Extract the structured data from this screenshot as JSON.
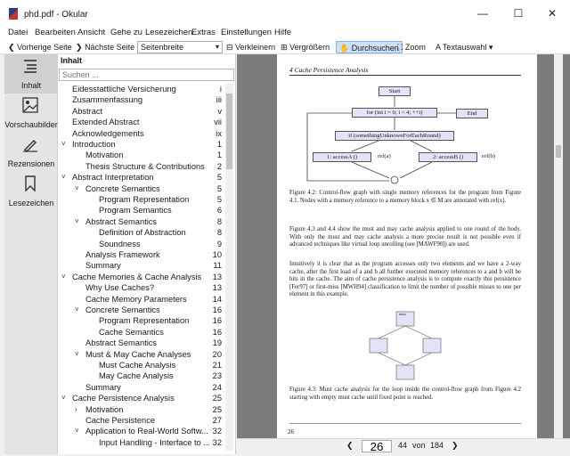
{
  "window": {
    "title": "phd.pdf - Okular",
    "minimize": "—",
    "maximize": "☐",
    "close": "✕"
  },
  "menu": [
    "Datei",
    "Bearbeiten",
    "Ansicht",
    "Gehe zu",
    "Lesezeichen",
    "Extras",
    "Einstellungen",
    "Hilfe"
  ],
  "toolbar": {
    "prev": "Vorherige Seite",
    "next": "Nächste Seite",
    "zoom_mode": "Seitenbreite",
    "zoom_out": "Verkleinern",
    "zoom_in": "Vergrößern",
    "browse": "Durchsuchen",
    "zoom": "Zoom",
    "text_select": "Textauswahl"
  },
  "sidebar": [
    {
      "label": "Inhalt",
      "icon": "contents-icon"
    },
    {
      "label": "Vorschaubilder",
      "icon": "thumbnails-icon"
    },
    {
      "label": "Rezensionen",
      "icon": "reviews-icon"
    },
    {
      "label": "Lesezeichen",
      "icon": "bookmarks-icon"
    }
  ],
  "toc": {
    "header": "Inhalt",
    "search_placeholder": "Suchen ...",
    "items": [
      {
        "label": "Eidesstattliche Versicherung",
        "page": "i",
        "level": 0,
        "arrow": ""
      },
      {
        "label": "Zusammenfassung",
        "page": "iii",
        "level": 0,
        "arrow": ""
      },
      {
        "label": "Abstract",
        "page": "v",
        "level": 0,
        "arrow": ""
      },
      {
        "label": "Extended Abstract",
        "page": "vii",
        "level": 0,
        "arrow": ""
      },
      {
        "label": "Acknowledgements",
        "page": "ix",
        "level": 0,
        "arrow": ""
      },
      {
        "label": "Introduction",
        "page": "1",
        "level": 0,
        "arrow": "down"
      },
      {
        "label": "Motivation",
        "page": "1",
        "level": 1,
        "arrow": ""
      },
      {
        "label": "Thesis Structure & Contributions",
        "page": "2",
        "level": 1,
        "arrow": ""
      },
      {
        "label": "Abstract Interpretation",
        "page": "5",
        "level": 0,
        "arrow": "down"
      },
      {
        "label": "Concrete Semantics",
        "page": "5",
        "level": 1,
        "arrow": "down"
      },
      {
        "label": "Program Representation",
        "page": "5",
        "level": 2,
        "arrow": ""
      },
      {
        "label": "Program Semantics",
        "page": "6",
        "level": 2,
        "arrow": ""
      },
      {
        "label": "Abstract Semantics",
        "page": "8",
        "level": 1,
        "arrow": "down"
      },
      {
        "label": "Definition of Abstraction",
        "page": "8",
        "level": 2,
        "arrow": ""
      },
      {
        "label": "Soundness",
        "page": "9",
        "level": 2,
        "arrow": ""
      },
      {
        "label": "Analysis Framework",
        "page": "10",
        "level": 1,
        "arrow": ""
      },
      {
        "label": "Summary",
        "page": "11",
        "level": 1,
        "arrow": ""
      },
      {
        "label": "Cache Memories & Cache Analysis",
        "page": "13",
        "level": 0,
        "arrow": "down"
      },
      {
        "label": "Why Use Caches?",
        "page": "13",
        "level": 1,
        "arrow": ""
      },
      {
        "label": "Cache Memory Parameters",
        "page": "14",
        "level": 1,
        "arrow": ""
      },
      {
        "label": "Concrete Semantics",
        "page": "16",
        "level": 1,
        "arrow": "down"
      },
      {
        "label": "Program Representation",
        "page": "16",
        "level": 2,
        "arrow": ""
      },
      {
        "label": "Cache Semantics",
        "page": "16",
        "level": 2,
        "arrow": ""
      },
      {
        "label": "Abstract Semantics",
        "page": "19",
        "level": 1,
        "arrow": ""
      },
      {
        "label": "Must & May Cache Analyses",
        "page": "20",
        "level": 1,
        "arrow": "down"
      },
      {
        "label": "Must Cache Analysis",
        "page": "21",
        "level": 2,
        "arrow": ""
      },
      {
        "label": "May Cache Analysis",
        "page": "23",
        "level": 2,
        "arrow": ""
      },
      {
        "label": "Summary",
        "page": "24",
        "level": 1,
        "arrow": ""
      },
      {
        "label": "Cache Persistence Analysis",
        "page": "25",
        "level": 0,
        "arrow": "down"
      },
      {
        "label": "Motivation",
        "page": "25",
        "level": 1,
        "arrow": "right"
      },
      {
        "label": "Cache Persistence",
        "page": "27",
        "level": 1,
        "arrow": ""
      },
      {
        "label": "Application to Real-World Softw...",
        "page": "32",
        "level": 1,
        "arrow": "down"
      },
      {
        "label": "Input Handling - Interface to ...",
        "page": "32",
        "level": 2,
        "arrow": ""
      }
    ]
  },
  "document": {
    "running_head": "4  Cache Persistence Analysis",
    "flow": {
      "start": "Start",
      "loop": "for (int i = 0; i < 4; ++i)",
      "end": "End",
      "cond": "if (somethingUnknownForEachRound)",
      "access_a": "1: accessA ()",
      "access_b": "2: accessB ()",
      "ref_a": "ref(a)",
      "ref_b": "ref(b)"
    },
    "caption_42": "Figure 4.2: Control-flow graph with single memory references for the program from Figure 4.1. Nodes with a memory reference to a memory block x ∈ M are annotated with ref(x).",
    "para1": "Figure 4.3 and 4.4 show the must and may cache analysis applied to one round of the body. With only the must and may cache analysis a more precise result is not possible even if advanced techniques like virtual loop unrolling (see [MAWF98]) are used.",
    "para2": "Intuitively it is clear that as the program accesses only two elements and we have a 2-way cache, after the first load of a and b all further executed memory references to a and b will be hits in the cache. The aim of cache persistence analysis is to compute exactly this persistence [Fer97] or first-miss [MWH94] classification to limit the number of possible misses to one per element in this example.",
    "caption_43": "Figure 4.3: Must cache analysis for the loop inside the control-flow graph from Figure 4.2 starting with empty must cache until fixed point is reached.",
    "page_number": "26",
    "mini_label": "must"
  },
  "status": {
    "current_page": "26",
    "total_pages": "44",
    "of_label": "von",
    "total_label": "184"
  }
}
